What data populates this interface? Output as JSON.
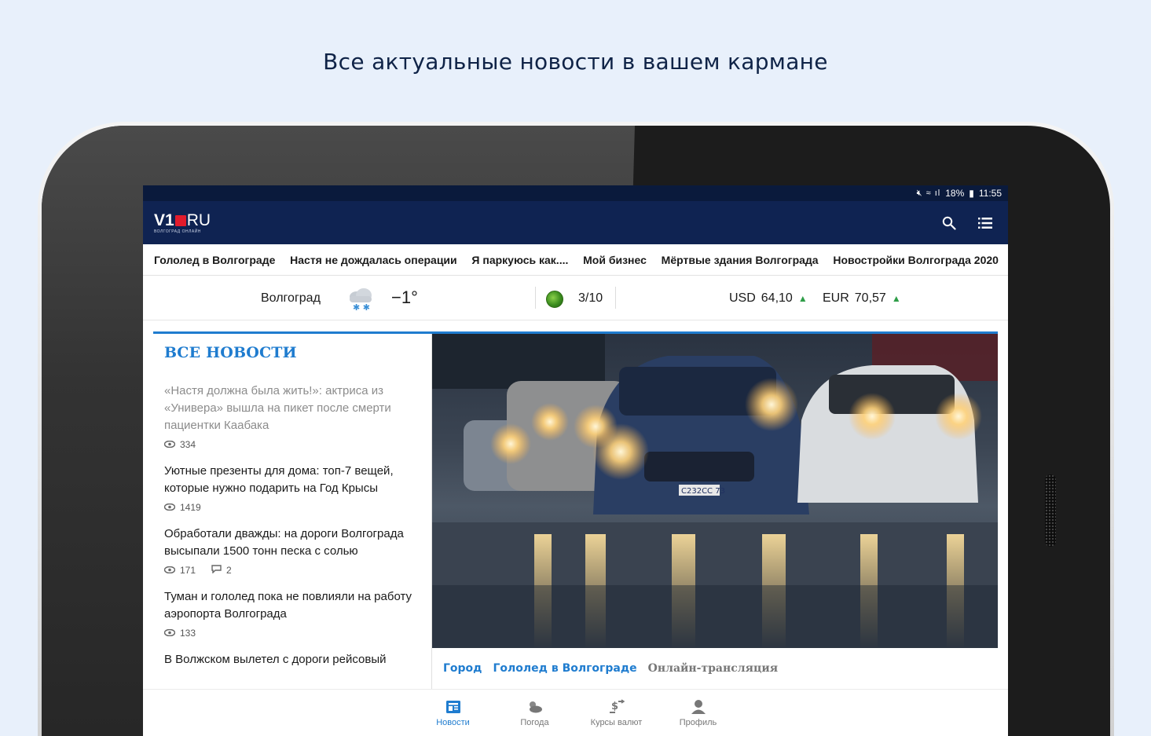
{
  "promo": {
    "title": "Все актуальные новости в вашем кармане"
  },
  "statusbar": {
    "battery": "18%",
    "time": "11:55"
  },
  "header": {
    "logo_main": "V1",
    "logo_ru": "RU",
    "logo_sub": "ВОЛГОГРАД ОНЛАЙН"
  },
  "tags": [
    "Гололед в Волгограде",
    "Настя не дождалась операции",
    "Я паркуюсь как....",
    "Мой бизнес",
    "Мёртвые здания Волгограда",
    "Новостройки Волгограда 2020"
  ],
  "info": {
    "city": "Волгоград",
    "temperature": "−1°",
    "traffic": "3/10",
    "usd_label": "USD",
    "usd_value": "64,10",
    "eur_label": "EUR",
    "eur_value": "70,57",
    "trend_symbol": "▲"
  },
  "news": {
    "section_title": "ВСЕ НОВОСТИ",
    "items": [
      {
        "title": "«Настя должна была жить!»: актриса из «Универа» вышла на пикет после смерти пациентки Каабака",
        "views": "334",
        "comments": "",
        "read": true
      },
      {
        "title": "Уютные презенты для дома: топ-7 вещей, которые нужно подарить на Год Крысы",
        "views": "1419",
        "comments": "",
        "read": false
      },
      {
        "title": "Обработали дважды: на дороги Волгограда высыпали 1500 тонн песка с солью",
        "views": "171",
        "comments": "2",
        "read": false
      },
      {
        "title": "Туман и гололед пока не повлияли на работу аэропорта Волгограда",
        "views": "133",
        "comments": "",
        "read": false
      },
      {
        "title": "В Волжском вылетел с дороги рейсовый",
        "views": "",
        "comments": "",
        "read": false
      }
    ]
  },
  "featured": {
    "plate": "С232СС 73",
    "tags": [
      "Город",
      "Гололед в Волгограде"
    ],
    "tag_grey": "Онлайн-трансляция"
  },
  "bottom_nav": [
    {
      "label": "Новости",
      "icon": "news-icon",
      "active": true
    },
    {
      "label": "Погода",
      "icon": "weather-icon",
      "active": false
    },
    {
      "label": "Курсы валют",
      "icon": "currency-icon",
      "active": false
    },
    {
      "label": "Профиль",
      "icon": "profile-icon",
      "active": false
    }
  ],
  "colors": {
    "accent": "#1f7ccf",
    "header": "#0f2352",
    "trend_up": "#2e9d48"
  }
}
